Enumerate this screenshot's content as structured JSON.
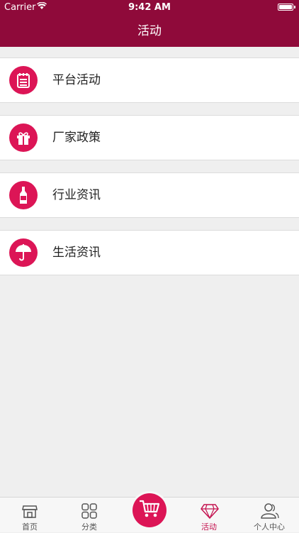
{
  "status_bar": {
    "carrier": "Carrier",
    "time": "9:42 AM"
  },
  "nav": {
    "title": "活动"
  },
  "menu": {
    "items": [
      {
        "label": "平台活动",
        "icon": "notepad-icon"
      },
      {
        "label": "厂家政策",
        "icon": "gift-icon"
      },
      {
        "label": "行业资讯",
        "icon": "bottle-icon"
      },
      {
        "label": "生活资讯",
        "icon": "umbrella-icon"
      }
    ]
  },
  "tabbar": {
    "tabs": [
      {
        "label": "首页",
        "icon": "shop-icon"
      },
      {
        "label": "分类",
        "icon": "grid-icon"
      },
      {
        "label": "",
        "icon": "cart-icon"
      },
      {
        "label": "活动",
        "icon": "diamond-icon",
        "active": true
      },
      {
        "label": "个人中心",
        "icon": "user-icon"
      }
    ]
  },
  "colors": {
    "brand": "#8f0a3a",
    "accent": "#dc1556",
    "active_tab": "#c4124f"
  }
}
